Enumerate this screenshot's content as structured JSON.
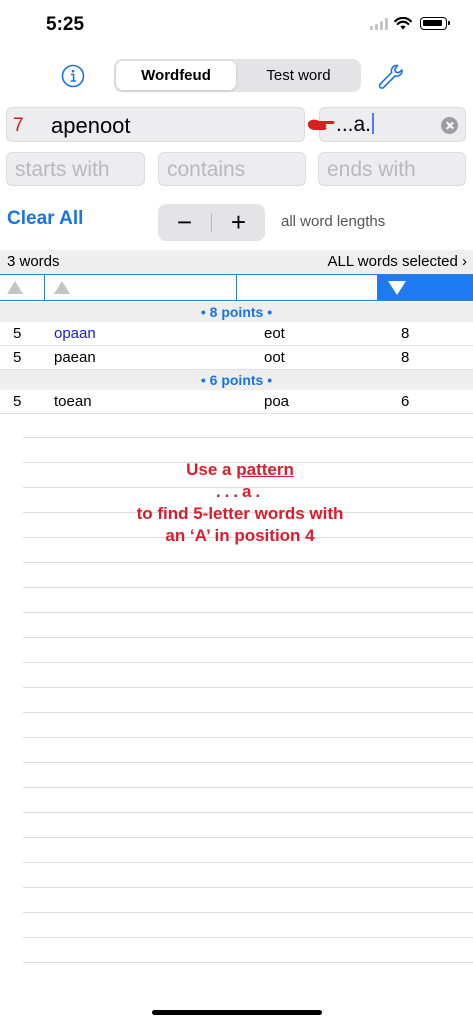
{
  "status_bar": {
    "time": "5:25"
  },
  "nav": {
    "tabs": [
      {
        "label": "Wordfeud",
        "selected": true
      },
      {
        "label": "Test word",
        "selected": false
      }
    ],
    "info_icon": "info-icon",
    "settings_icon": "wrench-icon"
  },
  "search": {
    "rack_count": "7",
    "rack_letters": "apenoot",
    "pattern_value": "...a.",
    "starts_with_placeholder": "starts with",
    "contains_placeholder": "contains",
    "ends_with_placeholder": "ends with"
  },
  "controls": {
    "clear_all_label": "Clear All",
    "minus_label": "−",
    "plus_label": "+",
    "word_lengths_label": "all word lengths"
  },
  "summary": {
    "word_count": "3 words",
    "selection_label": "ALL words selected ›"
  },
  "results": {
    "groups": [
      {
        "header": "• 8 points •",
        "rows": [
          {
            "length": "5",
            "word": "opaan",
            "rest": "eot",
            "points": "8"
          },
          {
            "length": "5",
            "word": "paean",
            "rest": "oot",
            "points": "8"
          }
        ]
      },
      {
        "header": "• 6 points •",
        "rows": [
          {
            "length": "5",
            "word": "toean",
            "rest": "poa",
            "points": "6"
          }
        ]
      }
    ]
  },
  "hint": {
    "line1_prefix": "Use a ",
    "line1_link": "pattern",
    "pattern": "...a.",
    "line3": "to find 5-letter words with",
    "line4": "an ‘A’ in position 4"
  },
  "colors": {
    "accent": "#1874e8",
    "hint": "#dd1c2b",
    "rack_count": "#c91f16",
    "highlight_word": "#1a1ad6"
  }
}
